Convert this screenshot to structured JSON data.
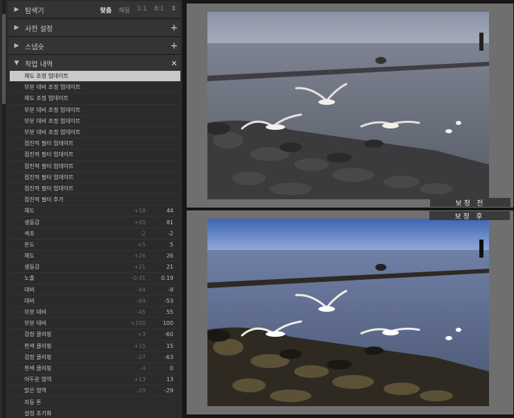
{
  "navigator": {
    "title": "탐색기",
    "options": [
      "맞춤",
      "채움",
      "1:1",
      "8:1"
    ],
    "selected": "맞춤"
  },
  "presets": {
    "title": "사전 설정"
  },
  "snapshots": {
    "title": "스냅숏"
  },
  "history": {
    "title": "작업 내역",
    "items": [
      {
        "label": "채도 조정 업데이트",
        "delta": "",
        "value": ""
      },
      {
        "label": "부분 대비 조정 업데이트",
        "delta": "",
        "value": ""
      },
      {
        "label": "채도 조정 업데이트",
        "delta": "",
        "value": ""
      },
      {
        "label": "부분 대비 조정 업데이트",
        "delta": "",
        "value": ""
      },
      {
        "label": "부분 대비 조정 업데이트",
        "delta": "",
        "value": ""
      },
      {
        "label": "부분 대비 조정 업데이트",
        "delta": "",
        "value": ""
      },
      {
        "label": "점진적 필터 업데이트",
        "delta": "",
        "value": ""
      },
      {
        "label": "점진적 필터 업데이트",
        "delta": "",
        "value": ""
      },
      {
        "label": "점진적 필터 업데이트",
        "delta": "",
        "value": ""
      },
      {
        "label": "점진적 필터 업데이트",
        "delta": "",
        "value": ""
      },
      {
        "label": "점진적 필터 업데이트",
        "delta": "",
        "value": ""
      },
      {
        "label": "점진적 필터 추가",
        "delta": "",
        "value": ""
      },
      {
        "label": "채도",
        "delta": "+18",
        "value": "44"
      },
      {
        "label": "생동감",
        "delta": "+60",
        "value": "81"
      },
      {
        "label": "색조",
        "delta": "-2",
        "value": "-2"
      },
      {
        "label": "온도",
        "delta": "+5",
        "value": "5"
      },
      {
        "label": "채도",
        "delta": "+26",
        "value": "26"
      },
      {
        "label": "생동감",
        "delta": "+21",
        "value": "21"
      },
      {
        "label": "노출",
        "delta": "-0.41",
        "value": "0.19"
      },
      {
        "label": "대비",
        "delta": "-44",
        "value": "-9"
      },
      {
        "label": "대비",
        "delta": "-69",
        "value": "-53"
      },
      {
        "label": "부분 대비",
        "delta": "-45",
        "value": "55"
      },
      {
        "label": "부분 대비",
        "delta": "+100",
        "value": "100"
      },
      {
        "label": "검정 클리핑",
        "delta": "+3",
        "value": "-60"
      },
      {
        "label": "흰색 클리핑",
        "delta": "+15",
        "value": "15"
      },
      {
        "label": "검정 클리핑",
        "delta": "-27",
        "value": "-63"
      },
      {
        "label": "흰색 클리핑",
        "delta": "-4",
        "value": "0"
      },
      {
        "label": "어두운 영역",
        "delta": "+13",
        "value": "13"
      },
      {
        "label": "밝은 영역",
        "delta": "-29",
        "value": "-29"
      },
      {
        "label": "자동 톤",
        "delta": "",
        "value": ""
      },
      {
        "label": "설정 초기화",
        "delta": "",
        "value": ""
      }
    ]
  },
  "views": {
    "before_label": "보정 전",
    "after_label": "보정 후"
  },
  "icons": {
    "expand": "triangle-right-icon",
    "collapse": "triangle-down-icon",
    "add": "plus-icon",
    "clear": "close-icon"
  },
  "colors": {
    "panel_bg": "#2b2b2b",
    "header_bg": "#343434",
    "selected_row": "#c9c9c9",
    "view_bg": "#6f6f6f"
  }
}
